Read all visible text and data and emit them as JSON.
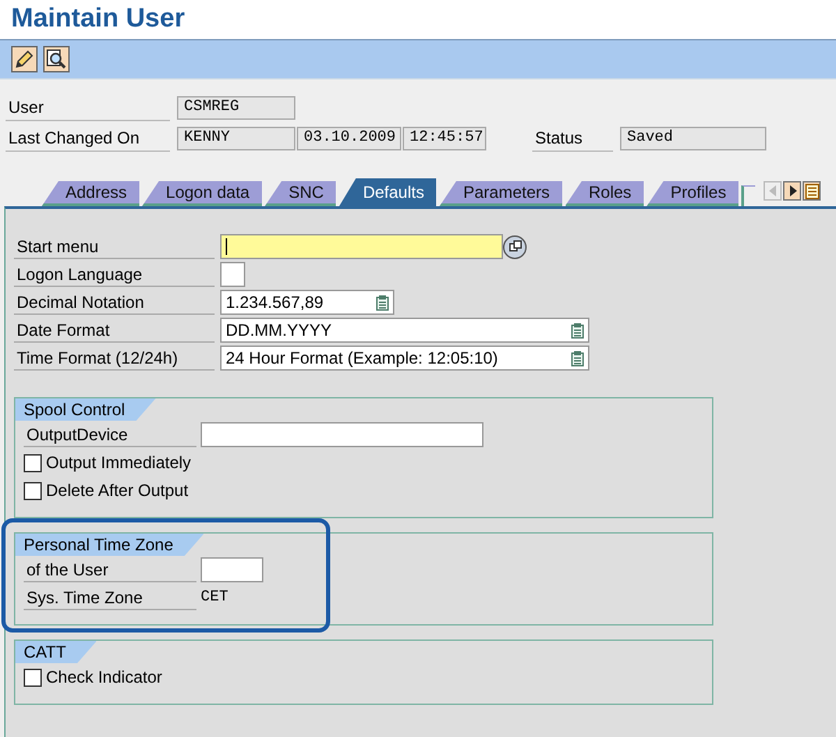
{
  "window": {
    "title": "Maintain User"
  },
  "header": {
    "user_label": "User",
    "user": "CSMREG",
    "changed_label": "Last Changed On",
    "changed_by": "KENNY",
    "changed_date": "03.10.2009",
    "changed_time": "12:45:57",
    "status_label": "Status",
    "status": "Saved"
  },
  "tabs": [
    {
      "label": "Address",
      "selected": false
    },
    {
      "label": "Logon data",
      "selected": false
    },
    {
      "label": "SNC",
      "selected": false
    },
    {
      "label": "Defaults",
      "selected": true
    },
    {
      "label": "Parameters",
      "selected": false
    },
    {
      "label": "Roles",
      "selected": false
    },
    {
      "label": "Profiles",
      "selected": false
    }
  ],
  "fields": [
    {
      "label": "Start menu",
      "kind": "search",
      "focused": true
    },
    {
      "label": "Logon Language",
      "kind": "input",
      "focused": false
    },
    {
      "label": "Decimal Notation",
      "kind": "dropdown",
      "value": "1.234.567,89",
      "focused": false
    },
    {
      "label": "Date Format",
      "kind": "dropdown",
      "value": "DD.MM.YYYY",
      "focused": false
    },
    {
      "label": "Time Format (12/24h)",
      "kind": "dropdown",
      "value": "24 Hour Format (Example: 12:05:10)",
      "focused": false
    }
  ],
  "groups": [
    {
      "title": "Spool Control",
      "highlighted": false,
      "items": [
        {
          "kind": "input",
          "label": "OutputDevice"
        },
        {
          "kind": "checkbox",
          "label": "Output Immediately",
          "checked": false
        },
        {
          "kind": "checkbox",
          "label": "Delete After Output",
          "checked": false
        }
      ]
    },
    {
      "title": "Personal Time Zone",
      "highlighted": true,
      "items": [
        {
          "kind": "input",
          "label": "of the User"
        },
        {
          "kind": "text",
          "label": "Sys. Time Zone",
          "value": "CET"
        }
      ]
    },
    {
      "title": "CATT",
      "highlighted": false,
      "items": [
        {
          "kind": "checkbox",
          "label": "Check Indicator",
          "checked": false
        }
      ]
    }
  ]
}
